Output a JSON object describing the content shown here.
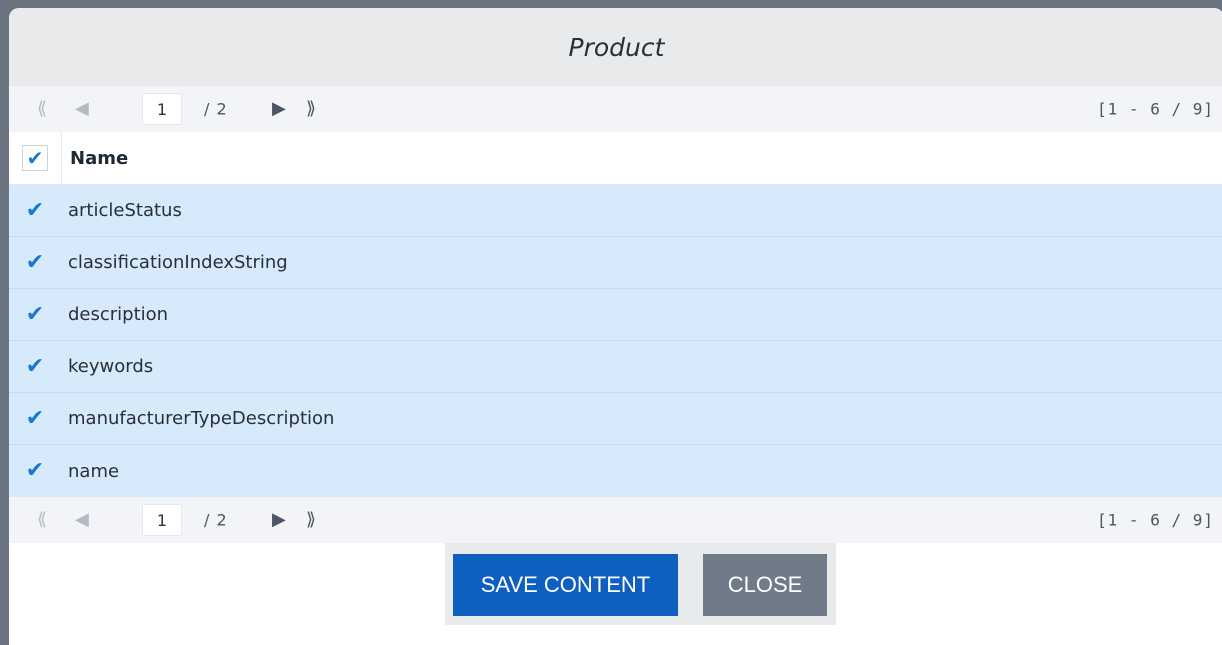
{
  "dialog": {
    "title": "Product"
  },
  "pager_top": {
    "page_value": "1",
    "total_pages": "/ 2",
    "range": "[1 - 6 / 9]"
  },
  "pager_bottom": {
    "page_value": "1",
    "total_pages": "/ 2",
    "range": "[1 - 6 / 9]"
  },
  "table": {
    "header": "Name",
    "header_checked": true,
    "rows": [
      {
        "label": "articleStatus",
        "checked": true
      },
      {
        "label": "classificationIndexString",
        "checked": true
      },
      {
        "label": "description",
        "checked": true
      },
      {
        "label": "keywords",
        "checked": true
      },
      {
        "label": "manufacturerTypeDescription",
        "checked": true
      },
      {
        "label": "name",
        "checked": true
      }
    ]
  },
  "buttons": {
    "save_label": "SAVE CONTENT",
    "close_label": "CLOSE"
  },
  "colors": {
    "accent": "#1a78d4",
    "save_button": "#0f5fc1",
    "close_button": "#707b89",
    "row_selected": "#d6eafc"
  },
  "icons": {
    "first_page": "double-chevron-left-icon",
    "prev_page": "triangle-left-icon",
    "next_page": "triangle-right-icon",
    "last_page": "double-chevron-right-icon",
    "check": "check-icon"
  }
}
